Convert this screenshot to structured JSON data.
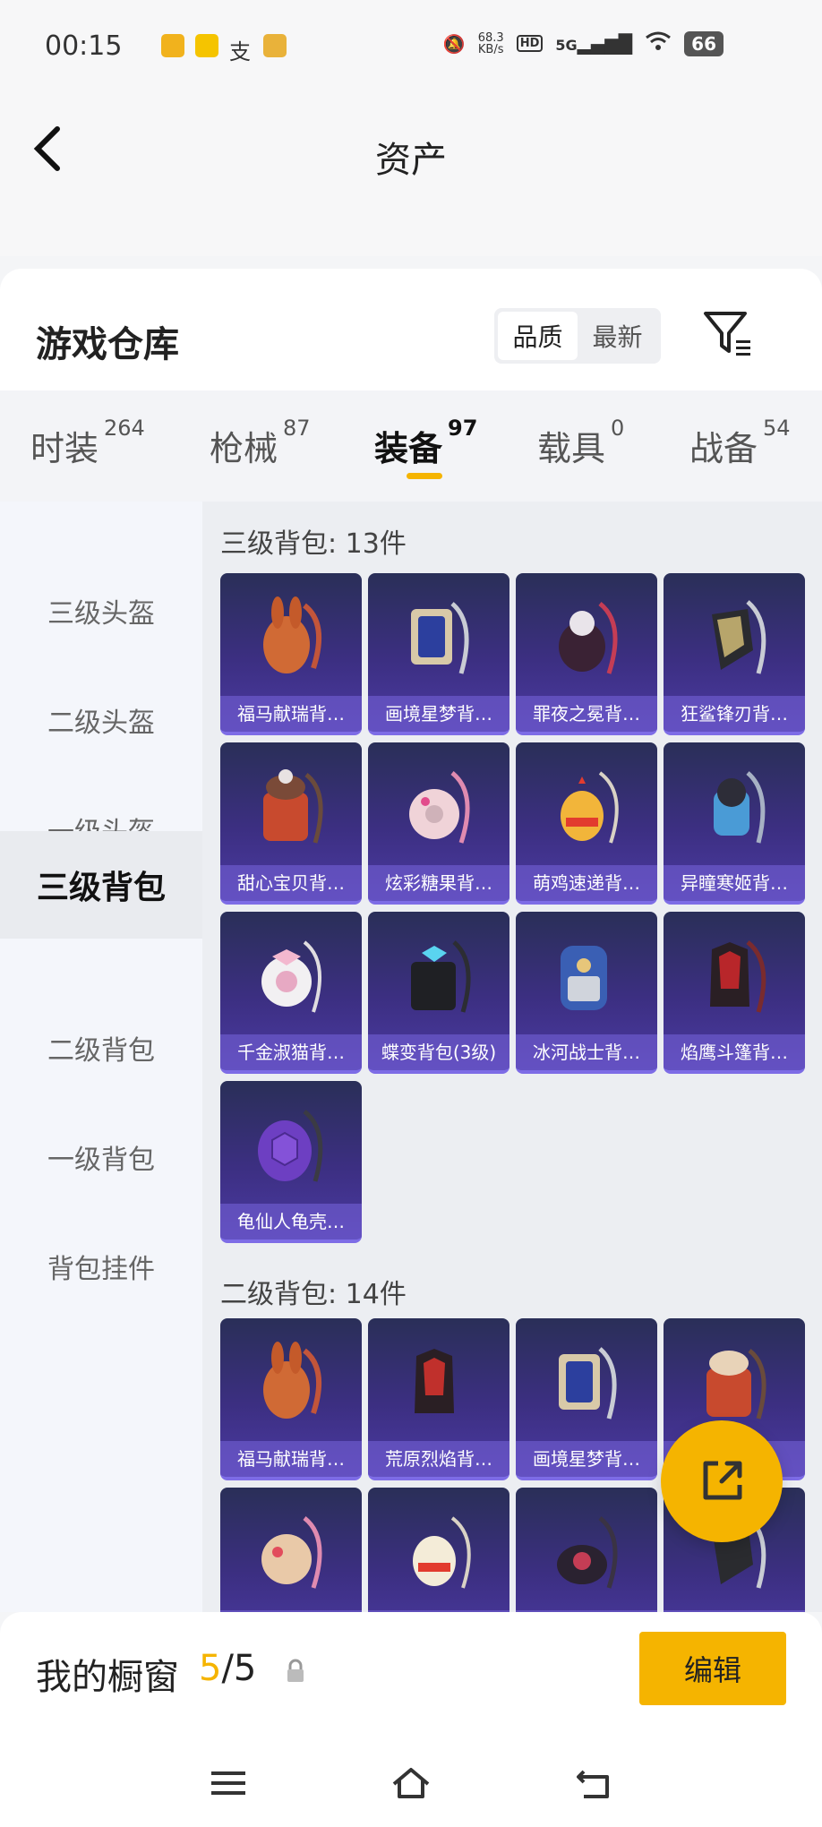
{
  "status_bar": {
    "time": "00:15",
    "net_speed": "68.3",
    "net_unit": "KB/s",
    "hd": "HD",
    "signal": "5G",
    "battery": "66"
  },
  "header": {
    "title": "资产"
  },
  "warehouse": {
    "title": "游戏仓库",
    "sort_options": [
      "品质",
      "最新"
    ],
    "active_sort": "品质"
  },
  "tabs": [
    {
      "label": "时装",
      "count": "264"
    },
    {
      "label": "枪械",
      "count": "87"
    },
    {
      "label": "装备",
      "count": "97"
    },
    {
      "label": "载具",
      "count": "0"
    },
    {
      "label": "战备",
      "count": "54"
    }
  ],
  "sidebar": {
    "items": [
      "三级头盔",
      "二级头盔",
      "一级头盔",
      "三级背包",
      "二级背包",
      "一级背包",
      "背包挂件"
    ],
    "active_index": 3
  },
  "sections": [
    {
      "title": "三级背包: 13件",
      "items": [
        "福马献瑞背…",
        "画境星梦背…",
        "罪夜之冕背…",
        "狂鲨锋刃背…",
        "甜心宝贝背…",
        "炫彩糖果背…",
        "萌鸡速递背…",
        "异瞳寒姬背…",
        "千金淑猫背…",
        "蝶变背包(3级)",
        "冰河战士背…",
        "焰鹰斗篷背…",
        "龟仙人龟壳…"
      ]
    },
    {
      "title": "二级背包: 14件",
      "items": [
        "福马献瑞背…",
        "荒原烈焰背…",
        "画境星梦背…",
        "",
        "",
        "",
        "",
        ""
      ]
    }
  ],
  "showcase": {
    "title": "我的橱窗",
    "count_current": "5",
    "count_sep_total": "/5",
    "edit_label": "编辑"
  },
  "colors": {
    "accent": "#f5b400",
    "card_bg": "#3c2f82",
    "card_border": "#7d6ce6"
  }
}
